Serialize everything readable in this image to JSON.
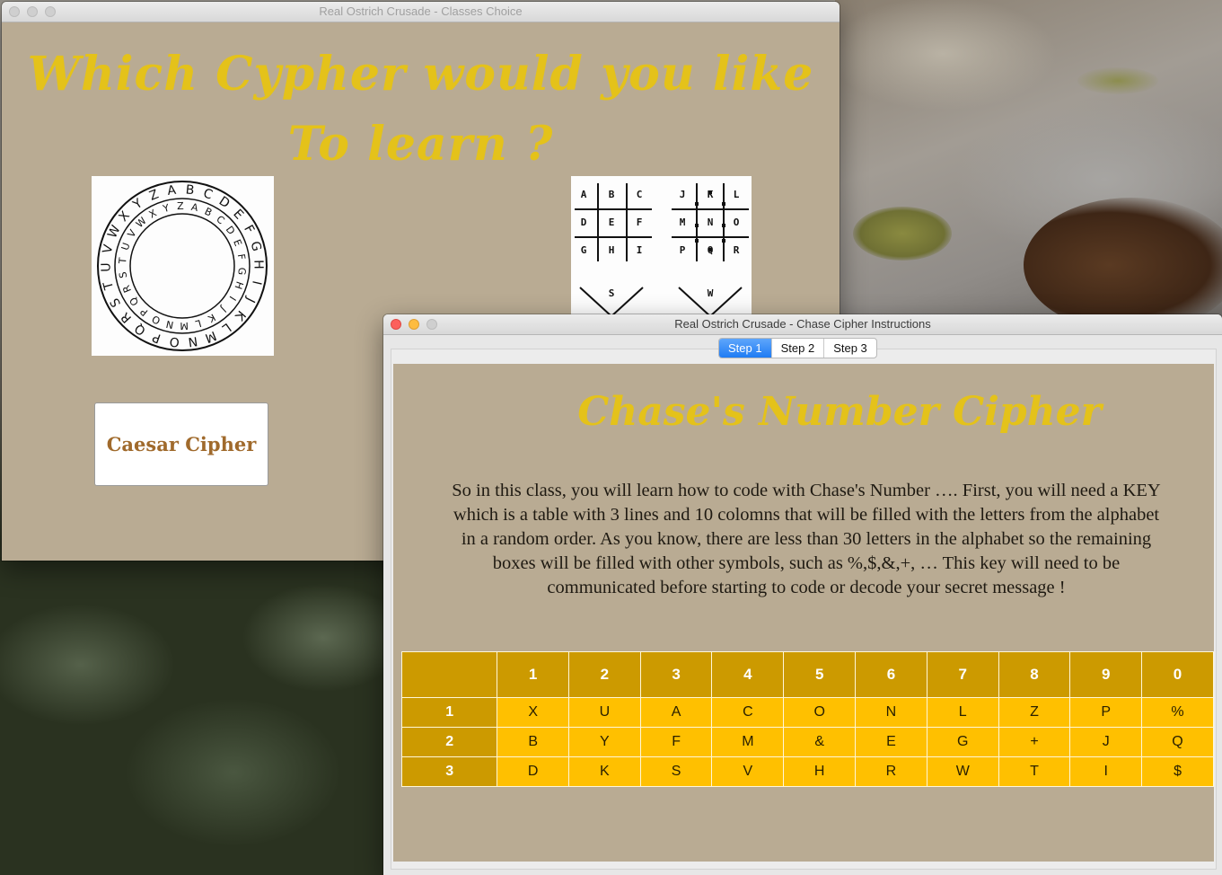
{
  "classes_window": {
    "title": "Real Ostrich Crusade - Classes Choice",
    "heading_line1": "Which Cypher would you like",
    "heading_line2": "To learn ?",
    "caesar_button_label": "Caesar Cipher",
    "caesar_wheel_outer": "ABCDEFGHIJKLMNOPQRSTUVWXYZ",
    "caesar_wheel_inner": "ABCDEFGHIJKLMNOPQRSTUVWXYZ",
    "pigpen_grid1": [
      "A",
      "B",
      "C",
      "D",
      "E",
      "F",
      "G",
      "H",
      "I"
    ],
    "pigpen_grid2": [
      "J",
      "K",
      "L",
      "M",
      "N",
      "O",
      "P",
      "Q",
      "R"
    ],
    "pigpen_x_letters": [
      "S",
      "W"
    ]
  },
  "instructions_window": {
    "title": "Real Ostrich Crusade - Chase Cipher Instructions",
    "tabs": [
      {
        "label": "Step 1",
        "selected": true
      },
      {
        "label": "Step 2",
        "selected": false
      },
      {
        "label": "Step 3",
        "selected": false
      }
    ],
    "cipher_title": "Chase's Number Cipher",
    "instructions_text": "So in this class, you will learn how to code with Chase's Number …. First, you will need a KEY which is a table with 3 lines and 10 colomns that will be filled with the letters from the alphabet in a random order. As you know, there are less than 30 letters in the alphabet so the remaining boxes will be filled with other symbols, such as %,$,&,+, … This key will need to be communicated before starting to code or decode your secret message !",
    "key_table": {
      "columns": [
        "1",
        "2",
        "3",
        "4",
        "5",
        "6",
        "7",
        "8",
        "9",
        "0"
      ],
      "rows": [
        {
          "label": "1",
          "cells": [
            "X",
            "U",
            "A",
            "C",
            "O",
            "N",
            "L",
            "Z",
            "P",
            "%"
          ]
        },
        {
          "label": "2",
          "cells": [
            "B",
            "Y",
            "F",
            "M",
            "&",
            "E",
            "G",
            "+",
            "J",
            "Q"
          ]
        },
        {
          "label": "3",
          "cells": [
            "D",
            "K",
            "S",
            "V",
            "H",
            "R",
            "W",
            "T",
            "I",
            "$"
          ]
        }
      ]
    }
  },
  "colors": {
    "window_bg": "#b9ab93",
    "title_gold": "#e4c21a",
    "table_header": "#cc9a00",
    "table_cell": "#ffc000",
    "button_text": "#a06a2c"
  }
}
